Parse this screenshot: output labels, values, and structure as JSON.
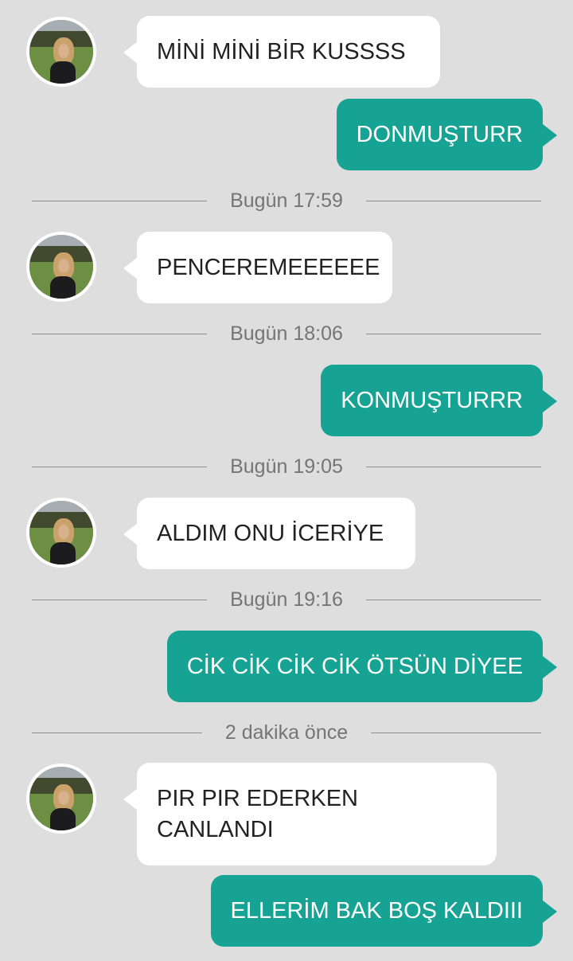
{
  "conversation": {
    "messages": [
      {
        "direction": "incoming",
        "text": "MİNİ MİNİ BİR KUSSSS"
      },
      {
        "direction": "outgoing",
        "text": "DONMUŞTURR"
      },
      {
        "direction": "separator",
        "text": "Bugün 17:59"
      },
      {
        "direction": "incoming",
        "text": "PENCEREMEEEEEE"
      },
      {
        "direction": "separator",
        "text": "Bugün 18:06"
      },
      {
        "direction": "outgoing",
        "text": "KONMUŞTURRR"
      },
      {
        "direction": "separator",
        "text": "Bugün 19:05"
      },
      {
        "direction": "incoming",
        "text": "ALDIM ONU İCERİYE"
      },
      {
        "direction": "separator",
        "text": "Bugün 19:16"
      },
      {
        "direction": "outgoing",
        "text": "CİK CİK CİK CİK ÖTSÜN DİYEE"
      },
      {
        "direction": "separator",
        "text": "2 dakika önce"
      },
      {
        "direction": "incoming",
        "text_line1": "PIR PIR EDERKEN",
        "text_line2": "CANLANDI"
      },
      {
        "direction": "outgoing",
        "text": "ELLERİM BAK BOŞ KALDIII"
      }
    ]
  },
  "colors": {
    "background": "#dedede",
    "incoming_bubble": "#ffffff",
    "outgoing_bubble": "#17a394",
    "separator_text": "#757575"
  }
}
